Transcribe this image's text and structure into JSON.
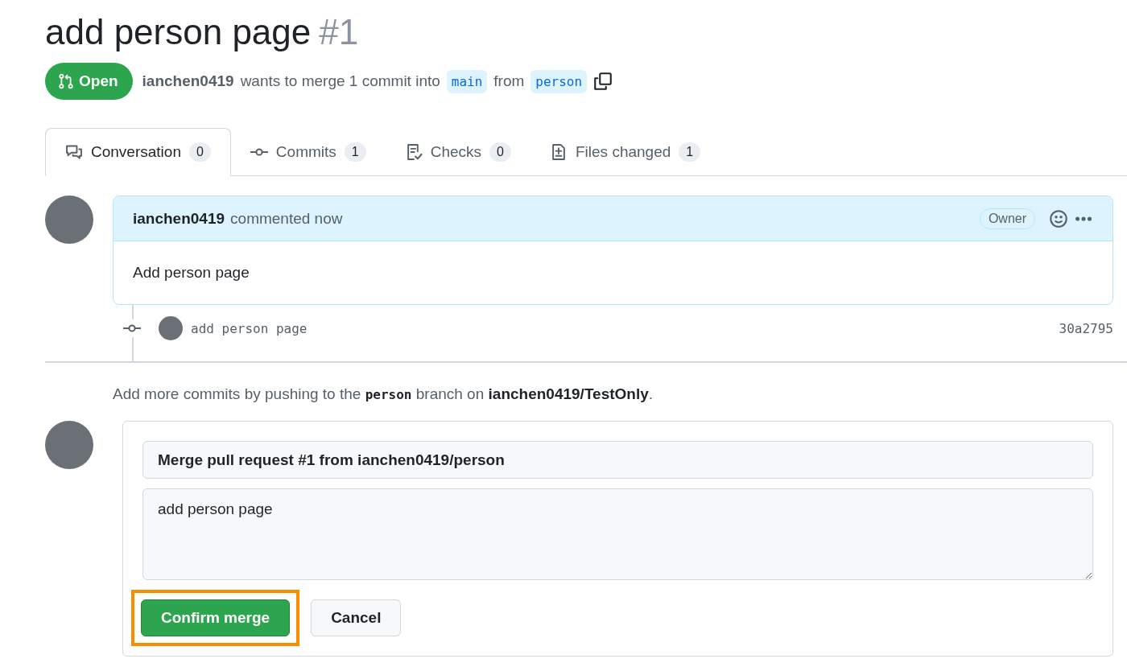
{
  "pull_request": {
    "title": "add person page",
    "number": "#1",
    "state": "Open",
    "author": "ianchen0419",
    "summary": "wants to merge 1 commit into",
    "base_branch": "main",
    "from_word": "from",
    "head_branch": "person"
  },
  "tabs": [
    {
      "label": "Conversation",
      "count": "0",
      "selected": true,
      "kind": "comment"
    },
    {
      "label": "Commits",
      "count": "1",
      "selected": false,
      "kind": "commit"
    },
    {
      "label": "Checks",
      "count": "0",
      "selected": false,
      "kind": "checklist"
    },
    {
      "label": "Files changed",
      "count": "1",
      "selected": false,
      "kind": "diff"
    }
  ],
  "comment": {
    "author": "ianchen0419",
    "meta": "commented now",
    "role": "Owner",
    "body": "Add person page"
  },
  "commits": [
    {
      "message": "add person page",
      "sha": "30a2795"
    }
  ],
  "hint": "Add more commits by pushing to the **person** branch on **ianchen0419/TestOnly**.",
  "merge_form": {
    "title_value": "Merge pull request #1 from ianchen0419/person",
    "message_value": "add person page",
    "confirm_label": "Confirm merge",
    "confirm_highlighted": true,
    "cancel_label": "Cancel"
  }
}
